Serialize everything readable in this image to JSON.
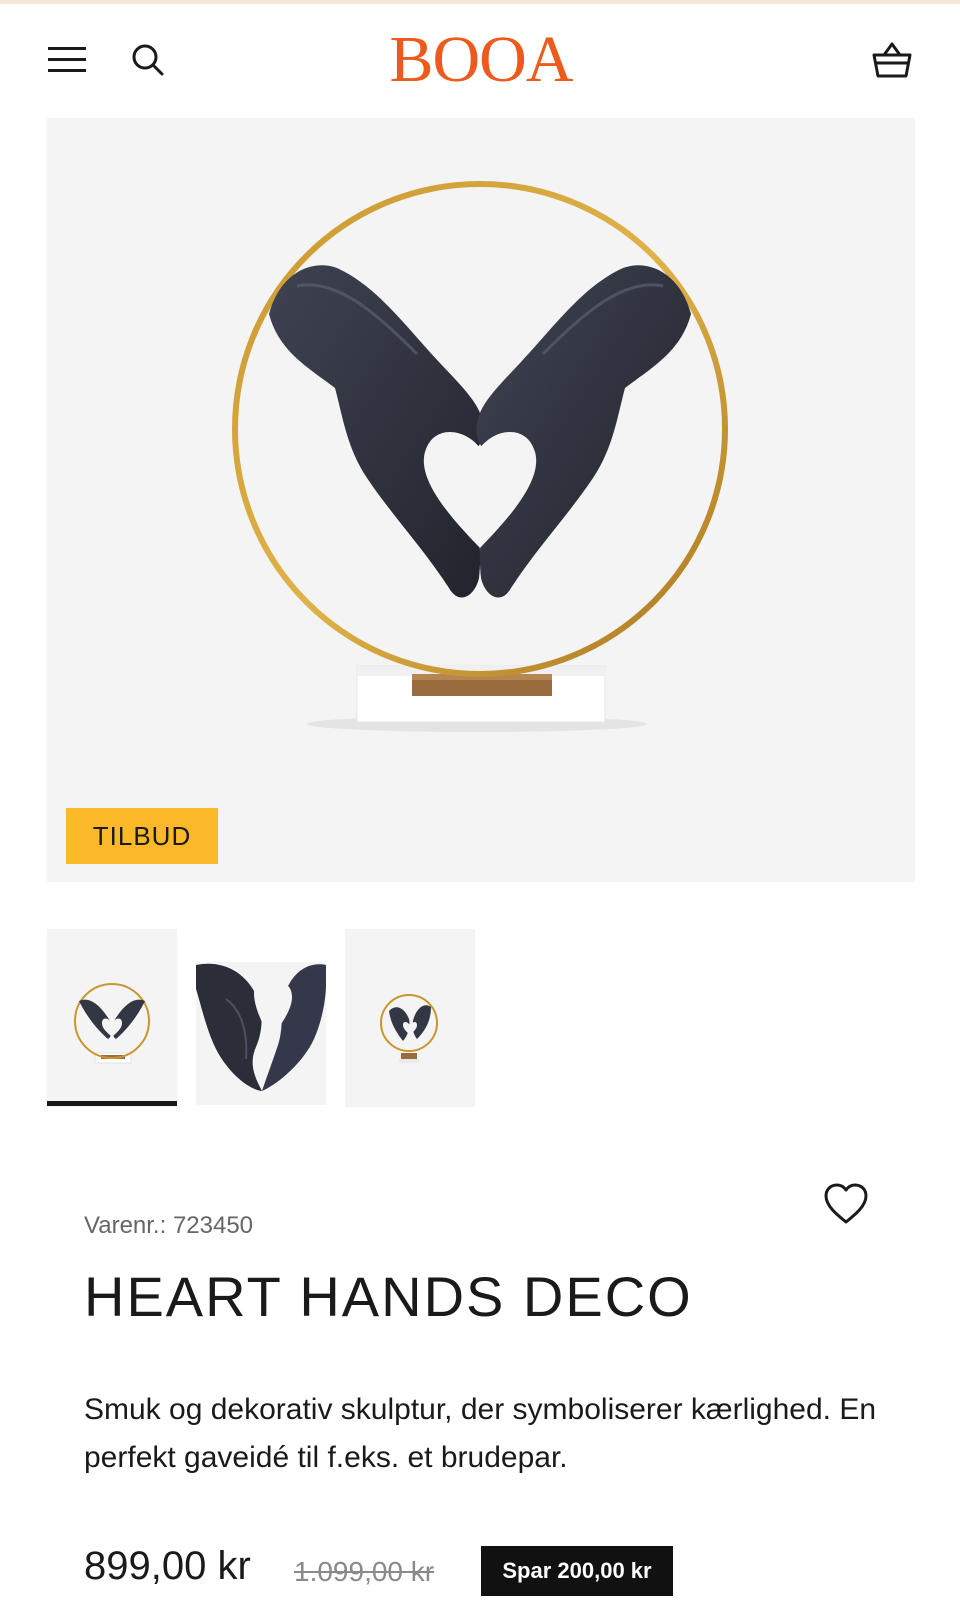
{
  "header": {
    "logo": "BOOA",
    "menu_icon": "hamburger-menu-icon",
    "search_icon": "search-icon",
    "cart_icon": "shopping-basket-icon",
    "brand_color": "#ec5a1c"
  },
  "gallery": {
    "badge": "TILBUD",
    "badge_color": "#fbb829",
    "thumbnails": [
      {
        "name": "heart-hands-ring-front",
        "active": true
      },
      {
        "name": "heart-hands-closeup",
        "active": false
      },
      {
        "name": "heart-hands-ring-side",
        "active": false
      }
    ]
  },
  "product": {
    "sku_label": "Varenr.:",
    "sku_value": "723450",
    "title": "HEART HANDS DECO",
    "description": "Smuk og dekorativ skulptur, der symboliserer kærlighed. En perfekt gaveidé til f.eks. et brudepar.",
    "price": "899,00 kr",
    "compare_price": "1.099,00 kr",
    "savings": "Spar 200,00 kr",
    "wishlist_icon": "heart-outline-icon"
  }
}
